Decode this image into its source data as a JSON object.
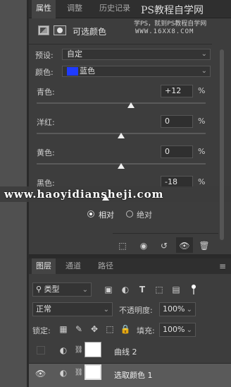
{
  "properties_panel": {
    "tabs": [
      "属性",
      "调整",
      "历史记录"
    ],
    "header_title": "可选颜色",
    "preset_label": "预设:",
    "preset_value": "自定",
    "colors_label": "颜色:",
    "colors_value": "蓝色",
    "colors_swatch": "#1f3bff",
    "sliders": [
      {
        "label": "青色:",
        "value": "+12",
        "unit": "%",
        "level": 12
      },
      {
        "label": "洋红:",
        "value": "0",
        "unit": "%",
        "level": 0
      },
      {
        "label": "黄色:",
        "value": "0",
        "unit": "%",
        "level": 0
      },
      {
        "label": "黑色:",
        "value": "-18",
        "unit": "%",
        "level": -18
      }
    ],
    "mode_options": [
      "相对",
      "绝对"
    ],
    "mode_selected": "相对"
  },
  "watermarks": {
    "top_title": "PS教程自学网",
    "top_sub": "学PS，就到PS教程自学网",
    "top_url": "WWW.16XX8.COM",
    "band_url": "www.haoyidianshejі.com"
  },
  "layers_panel": {
    "tabs": [
      "图层",
      "通道",
      "路径"
    ],
    "filter_label": "类型",
    "blend_mode": "正常",
    "opacity_label": "不透明度:",
    "opacity_value": "100%",
    "lock_label": "锁定:",
    "fill_label": "填充:",
    "fill_value": "100%",
    "layers": [
      {
        "name": "曲线 2"
      },
      {
        "name": "选取颜色 1"
      }
    ]
  }
}
